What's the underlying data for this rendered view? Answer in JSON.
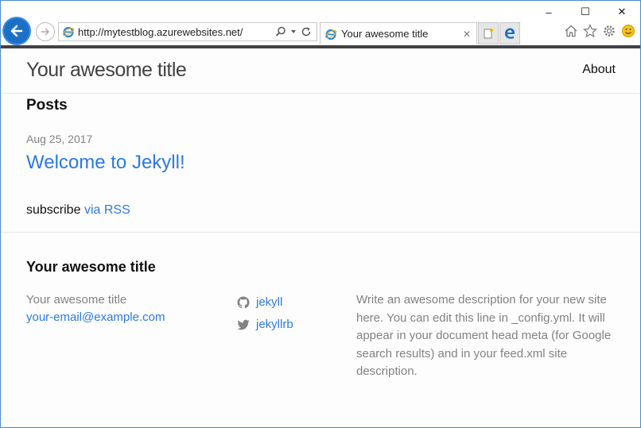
{
  "browser": {
    "url": "http://mytestblog.azurewebsites.net/",
    "tab_title": "Your awesome title",
    "icons": {
      "back": "back-arrow-icon",
      "forward": "forward-arrow-icon",
      "ie": "internet-explorer-icon",
      "search": "search-icon",
      "dropdown": "chevron-down-icon",
      "refresh": "refresh-icon",
      "tab_close": "close-icon",
      "new_tab": "new-tab-icon",
      "edge": "edge-icon",
      "home": "home-icon",
      "favorites": "star-icon",
      "settings": "gear-icon",
      "feedback": "smiley-icon"
    },
    "window_controls": {
      "minimize": "–",
      "maximize": "☐",
      "close": "✕"
    }
  },
  "site": {
    "title": "Your awesome title",
    "nav_about": "About"
  },
  "main": {
    "posts_heading": "Posts",
    "posts": [
      {
        "date": "Aug 25, 2017",
        "title": "Welcome to Jekyll!"
      }
    ],
    "subscribe_prefix": "subscribe",
    "subscribe_link": "via RSS"
  },
  "footer": {
    "heading": "Your awesome title",
    "name": "Your awesome title",
    "email": "your-email@example.com",
    "github_user": "jekyll",
    "twitter_user": "jekyllrb",
    "description": "Write an awesome description for your new site here. You can edit this line in _config.yml. It will appear in your document head meta (for Google search results) and in your feed.xml site description."
  },
  "colors": {
    "link": "#2a7ae2",
    "muted": "#828282",
    "text": "#111111",
    "ie_blue": "#1c6fc7"
  }
}
